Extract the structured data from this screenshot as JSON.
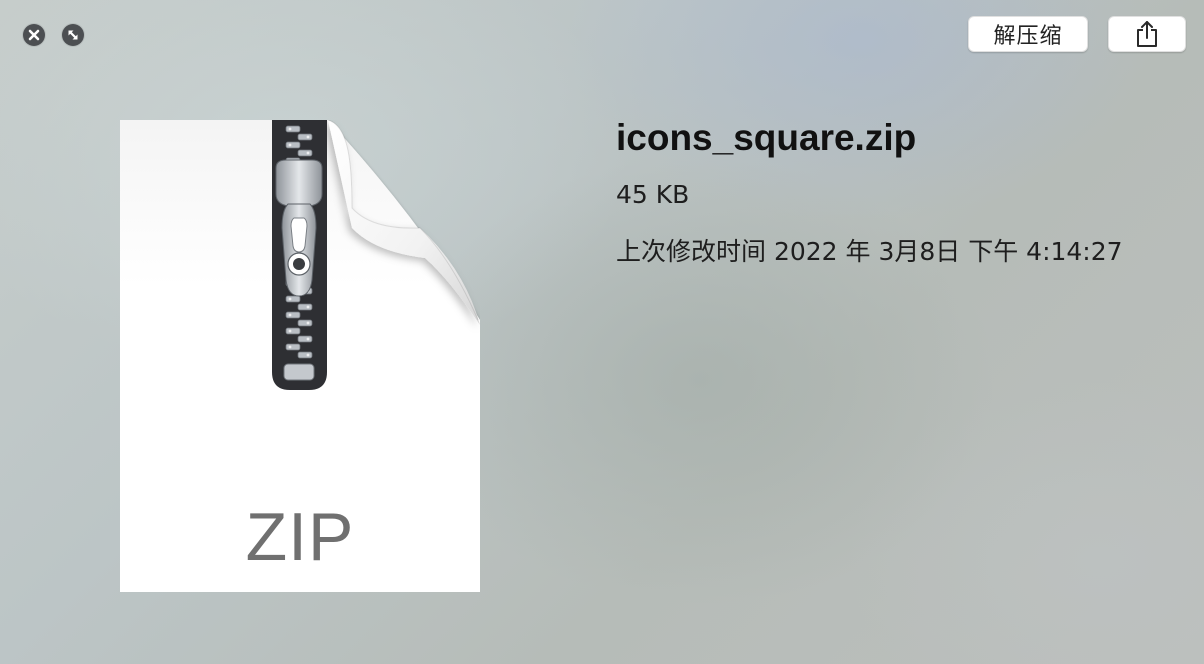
{
  "window_controls": {
    "close": "close-icon",
    "fullscreen": "fullscreen-icon"
  },
  "toolbar": {
    "decompress_label": "解压缩",
    "share_icon": "share-icon"
  },
  "preview": {
    "icon": "zip-file-icon",
    "extension_label": "ZIP"
  },
  "file": {
    "name": "icons_square.zip",
    "size": "45 KB",
    "modified": "上次修改时间 2022 年 3月8日 下午 4:14:27"
  },
  "colors": {
    "button_bg": "#ffffff",
    "control_bg": "#4c4f52",
    "zipper_tape": "#2e2f33",
    "zipper_metal": "#b9bec4",
    "label_gray": "#707070"
  }
}
